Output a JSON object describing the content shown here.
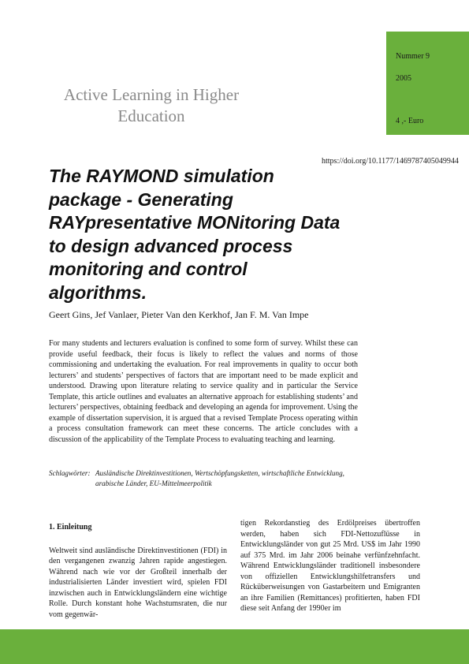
{
  "header": {
    "journal_title": "Active Learning in Higher Education",
    "issue_label": "Nummer 9",
    "year": "2005",
    "price": "4 ,- Euro",
    "doi": "https://doi.org/10.1177/1469787405049944"
  },
  "article": {
    "title": "The RAYMOND simulation package - Generating RAYpresentative MONitoring Data to design advanced process monitoring and control algorithms.",
    "authors": "Geert Gins, Jef Vanlaer, Pieter Van den Kerkhof, Jan F. M. Van Impe",
    "abstract": "For many students and lecturers evaluation is confined to some form of survey. Whilst these can provide useful feedback, their focus is likely to reflect the values and norms of those commissioning and undertaking the evaluation. For real improvements in quality to occur both lecturers’ and students’ perspectives of factors that are important need to be made explicit and understood. Drawing upon literature relating to service quality and in particular the Service Template, this article outlines and evaluates an alternative approach for establishing students’ and lecturers’ perspectives, obtaining feedback and developing an agenda for improvement. Using the example of dissertation supervision, it is argued that a revised Template Process operating within a process consultation framework can meet these concerns. The article concludes with a discussion of the applicability of the Template Process to evaluating teaching and learning.",
    "keywords_label": "Schlagwörter:",
    "keywords": "Ausländische Direktinvestitionen, Wertschöpfungsketten, wirtschaftliche Entwicklung, arabische Länder, EU-Mittelmeerpolitik"
  },
  "body": {
    "section_heading": "1.  Einleitung",
    "left_paragraph": "Weltweit sind ausländische Direktinvestitionen (FDI) in den vergangenen zwanzig Jahren rapide angestiegen. Während nach wie vor der Großteil innerhalb der industrialisierten Länder investiert wird, spielen FDI inzwischen auch in Entwicklungsländern eine wichtige Rolle. Durch konstant hohe Wachstumsraten, die nur vom gegenwär-",
    "right_paragraph": "tigen Rekordanstieg des Erdölpreises übertroffen werden, haben sich FDI-Nettozuflüsse in Entwicklungsländer von gut 25 Mrd. US$ im Jahr 1990 auf 375 Mrd. im Jahr 2006 beinahe verfünfzehnfacht. Während Entwicklungsländer traditionell insbesondere von offiziellen Entwicklungshilfetransfers und Rücküberweisungen von Gastarbeitern und Emigranten an ihre Familien (Remittances) profitierten, haben FDI diese seit Anfang der 1990er im"
  },
  "colors": {
    "accent_green": "#6ab03c",
    "journal_gray": "#8a8a8a"
  }
}
